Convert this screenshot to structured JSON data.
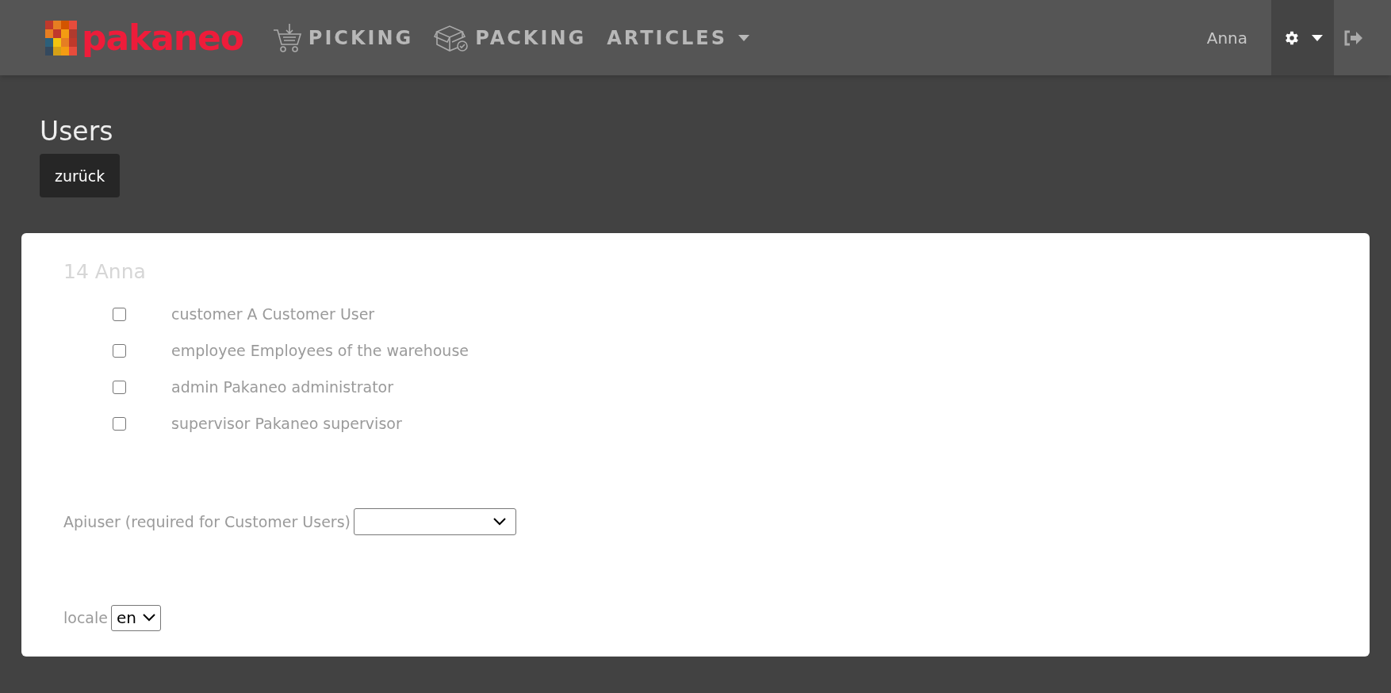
{
  "navbar": {
    "logo_text": "pakaneo",
    "nav_items": [
      {
        "kind": "picking",
        "label": "PICKING",
        "has_dropdown": false
      },
      {
        "kind": "packing",
        "label": "PACKING",
        "has_dropdown": false
      },
      {
        "kind": "plain",
        "label": "ARTICLES",
        "has_dropdown": true
      }
    ],
    "user_name": "Anna"
  },
  "page": {
    "title": "Users",
    "back_button": "zurück"
  },
  "form": {
    "heading": "14 Anna",
    "roles": [
      {
        "label": "customer A Customer User",
        "checked": false
      },
      {
        "label": "employee Employees of the warehouse",
        "checked": false
      },
      {
        "label": "admin Pakaneo administrator",
        "checked": false
      },
      {
        "label": "supervisor Pakaneo supervisor",
        "checked": false
      }
    ],
    "apiuser": {
      "label": "Apiuser (required for Customer Users)"
    },
    "locale": {
      "label": "locale",
      "value": "en"
    }
  }
}
